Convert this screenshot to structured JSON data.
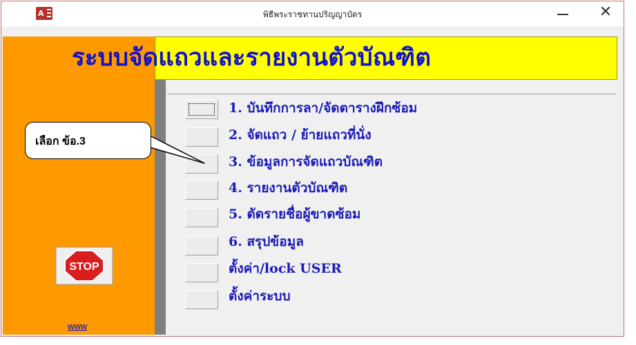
{
  "window": {
    "title": "พิธีพระราชทานปริญญาบัตร",
    "app_icon_text": "A",
    "minimize_symbol": "",
    "close_symbol": "✕"
  },
  "banner": {
    "title": "ระบบจัดแถวและรายงานตัวบัณฑิต"
  },
  "menu": {
    "items": [
      {
        "label": "1. บันทึกการลา/จัดตารางฝึกซ้อม"
      },
      {
        "label": "2. จัดแถว / ย้ายแถวที่นั่ง"
      },
      {
        "label": "3. ข้อมูลการจัดแถวบัณฑิต"
      },
      {
        "label": "4. รายงานตัวบัณฑิต"
      },
      {
        "label": "5. ตัดรายชื่อผู้ขาดซ้อม"
      },
      {
        "label": "6. สรุปข้อมูล"
      },
      {
        "label": "ตั้งค่า/lock  USER"
      },
      {
        "label": "ตั้งค่าระบบ"
      }
    ]
  },
  "callout": {
    "text": "เลือก ข้อ.3"
  },
  "sidebar": {
    "stop_label": "STOP",
    "link_text": "www"
  },
  "colors": {
    "banner_bg": "#ffff00",
    "banner_text": "#1111cc",
    "sidebar_bg": "#ff9900",
    "stop_red": "#d81e1e"
  }
}
